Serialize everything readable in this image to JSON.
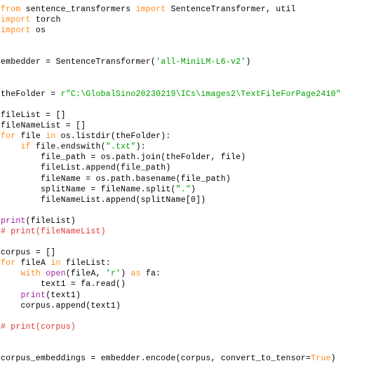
{
  "editor": {
    "language": "python",
    "background_color": "#ffffff",
    "syntax_colors": {
      "keyword": "#ff8c1a",
      "string": "#00a000",
      "builtin": "#a020a0",
      "comment": "#e03030",
      "plain": "#000000"
    }
  },
  "code": {
    "lines": [
      [
        {
          "t": "from",
          "c": "kw"
        },
        {
          "t": " sentence_transformers ",
          "c": "plain"
        },
        {
          "t": "import",
          "c": "kw"
        },
        {
          "t": " SentenceTransformer, util",
          "c": "plain"
        }
      ],
      [
        {
          "t": "import",
          "c": "kw"
        },
        {
          "t": " torch",
          "c": "plain"
        }
      ],
      [
        {
          "t": "import",
          "c": "kw"
        },
        {
          "t": " os",
          "c": "plain"
        }
      ],
      [],
      [],
      [
        {
          "t": "embedder = SentenceTransformer(",
          "c": "plain"
        },
        {
          "t": "'all-MiniLM-L6-v2'",
          "c": "str"
        },
        {
          "t": ")",
          "c": "plain"
        }
      ],
      [],
      [],
      [
        {
          "t": "theFolder = ",
          "c": "plain"
        },
        {
          "t": "r\"C:\\GlobalSino20230219\\ICs\\images2\\TextFileForPage2410\"",
          "c": "str"
        }
      ],
      [],
      [
        {
          "t": "fileList = []",
          "c": "plain"
        }
      ],
      [
        {
          "t": "fileNameList = []",
          "c": "plain"
        }
      ],
      [
        {
          "t": "for",
          "c": "kw"
        },
        {
          "t": " file ",
          "c": "plain"
        },
        {
          "t": "in",
          "c": "kw"
        },
        {
          "t": " os.listdir(theFolder):",
          "c": "plain"
        }
      ],
      [
        {
          "t": "    ",
          "c": "plain"
        },
        {
          "t": "if",
          "c": "kw"
        },
        {
          "t": " file.endswith(",
          "c": "plain"
        },
        {
          "t": "\".txt\"",
          "c": "str"
        },
        {
          "t": "):",
          "c": "plain"
        }
      ],
      [
        {
          "t": "        file_path = os.path.join(theFolder, file)",
          "c": "plain"
        }
      ],
      [
        {
          "t": "        fileList.append(file_path)",
          "c": "plain"
        }
      ],
      [
        {
          "t": "        fileName = os.path.basename(file_path)",
          "c": "plain"
        }
      ],
      [
        {
          "t": "        splitName = fileName.split(",
          "c": "plain"
        },
        {
          "t": "\".\"",
          "c": "str"
        },
        {
          "t": ")",
          "c": "plain"
        }
      ],
      [
        {
          "t": "        fileNameList.append(splitName[0])",
          "c": "plain"
        }
      ],
      [],
      [
        {
          "t": "print",
          "c": "builtin"
        },
        {
          "t": "(fileList)",
          "c": "plain"
        }
      ],
      [
        {
          "t": "# print(fileNameList)",
          "c": "comment"
        }
      ],
      [],
      [
        {
          "t": "corpus = []",
          "c": "plain"
        }
      ],
      [
        {
          "t": "for",
          "c": "kw"
        },
        {
          "t": " fileA ",
          "c": "plain"
        },
        {
          "t": "in",
          "c": "kw"
        },
        {
          "t": " fileList:",
          "c": "plain"
        }
      ],
      [
        {
          "t": "    ",
          "c": "plain"
        },
        {
          "t": "with",
          "c": "kw"
        },
        {
          "t": " ",
          "c": "plain"
        },
        {
          "t": "open",
          "c": "builtin"
        },
        {
          "t": "(fileA, ",
          "c": "plain"
        },
        {
          "t": "'r'",
          "c": "str"
        },
        {
          "t": ") ",
          "c": "plain"
        },
        {
          "t": "as",
          "c": "kw"
        },
        {
          "t": " fa:",
          "c": "plain"
        }
      ],
      [
        {
          "t": "        text1 = fa.read()",
          "c": "plain"
        }
      ],
      [
        {
          "t": "    ",
          "c": "plain"
        },
        {
          "t": "print",
          "c": "builtin"
        },
        {
          "t": "(text1)",
          "c": "plain"
        }
      ],
      [
        {
          "t": "    corpus.append(text1)",
          "c": "plain"
        }
      ],
      [],
      [
        {
          "t": "# print(corpus)",
          "c": "comment"
        }
      ],
      [],
      [],
      [
        {
          "t": "corpus_embeddings = embedder.encode(corpus, convert_to_tensor=",
          "c": "plain"
        },
        {
          "t": "True",
          "c": "kw"
        },
        {
          "t": ")",
          "c": "plain"
        }
      ]
    ]
  }
}
